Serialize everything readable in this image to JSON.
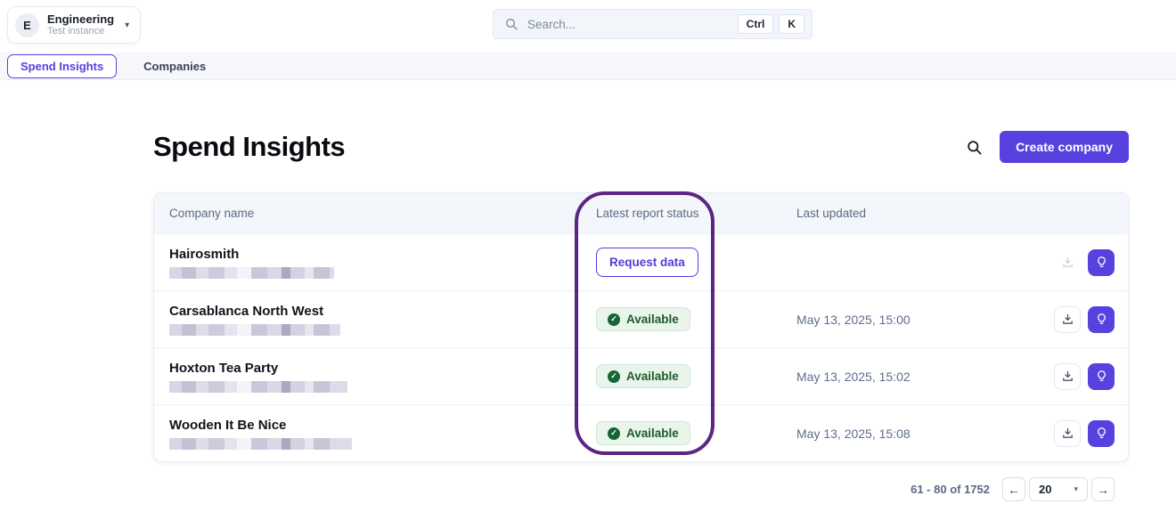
{
  "workspace": {
    "initial": "E",
    "name": "Engineering",
    "subtitle": "Test instance"
  },
  "search": {
    "placeholder": "Search...",
    "shortcut_keys": [
      "Ctrl",
      "K"
    ]
  },
  "tabs": [
    {
      "label": "Spend Insights",
      "active": true
    },
    {
      "label": "Companies",
      "active": false
    }
  ],
  "page": {
    "title": "Spend Insights",
    "create_button_label": "Create company"
  },
  "table": {
    "columns": [
      "Company name",
      "Latest report status",
      "Last updated"
    ],
    "rows": [
      {
        "name": "Hairosmith",
        "status": "Request data",
        "status_type": "request",
        "last_updated": ""
      },
      {
        "name": "Carsablanca North West",
        "status": "Available",
        "status_type": "available",
        "last_updated": "May 13, 2025, 15:00"
      },
      {
        "name": "Hoxton Tea Party",
        "status": "Available",
        "status_type": "available",
        "last_updated": "May 13, 2025, 15:02"
      },
      {
        "name": "Wooden It Be Nice",
        "status": "Available",
        "status_type": "available",
        "last_updated": "May 13, 2025, 15:08"
      }
    ]
  },
  "pagination": {
    "range_label": "61 - 80 of 1752",
    "page_size": "20"
  },
  "icons": {
    "caret_down": "▾",
    "select_caret": "▾",
    "check": "✓",
    "prev_arrow": "←",
    "next_arrow": "→"
  },
  "colors": {
    "accent": "#5742E0",
    "annotation": "#5C2483",
    "available_bg": "#E9F5EB",
    "available_text": "#1D5B2A",
    "table_header_bg": "#F3F6FA"
  }
}
